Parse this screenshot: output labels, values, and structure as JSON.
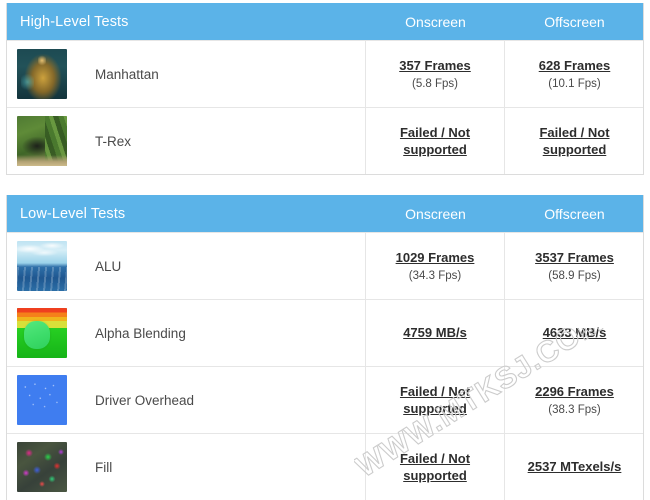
{
  "watermark": {
    "text": "WWW.MTKSJ.COM"
  },
  "theme": {
    "header_bg": "#5bb3e8",
    "header_text": "#ffffff",
    "border": "#e6e6e6",
    "value_text": "#2d2d2d",
    "label_text": "#4a4a4a"
  },
  "tables": [
    {
      "title": "High-Level Tests",
      "columns": [
        "Onscreen",
        "Offscreen"
      ],
      "rows": [
        {
          "name": "Manhattan",
          "thumb": "manhattan-thumbnail",
          "onscreen": {
            "main": "357 Frames",
            "sub": "(5.8 Fps)"
          },
          "offscreen": {
            "main": "628 Frames",
            "sub": "(10.1 Fps)"
          }
        },
        {
          "name": "T-Rex",
          "thumb": "trex-thumbnail",
          "onscreen": {
            "main": "Failed / Not supported",
            "sub": ""
          },
          "offscreen": {
            "main": "Failed / Not supported",
            "sub": ""
          }
        }
      ]
    },
    {
      "title": "Low-Level Tests",
      "columns": [
        "Onscreen",
        "Offscreen"
      ],
      "rows": [
        {
          "name": "ALU",
          "thumb": "alu-thumbnail",
          "onscreen": {
            "main": "1029 Frames",
            "sub": "(34.3 Fps)"
          },
          "offscreen": {
            "main": "3537 Frames",
            "sub": "(58.9 Fps)"
          }
        },
        {
          "name": "Alpha Blending",
          "thumb": "alpha-blending-thumbnail",
          "onscreen": {
            "main": "4759 MB/s",
            "sub": ""
          },
          "offscreen": {
            "main": "4633 MB/s",
            "sub": ""
          }
        },
        {
          "name": "Driver Overhead",
          "thumb": "driver-overhead-thumbnail",
          "onscreen": {
            "main": "Failed / Not supported",
            "sub": ""
          },
          "offscreen": {
            "main": "2296 Frames",
            "sub": "(38.3 Fps)"
          }
        },
        {
          "name": "Fill",
          "thumb": "fill-thumbnail",
          "onscreen": {
            "main": "Failed / Not supported",
            "sub": ""
          },
          "offscreen": {
            "main": "2537 MTexels/s",
            "sub": ""
          }
        }
      ]
    }
  ]
}
